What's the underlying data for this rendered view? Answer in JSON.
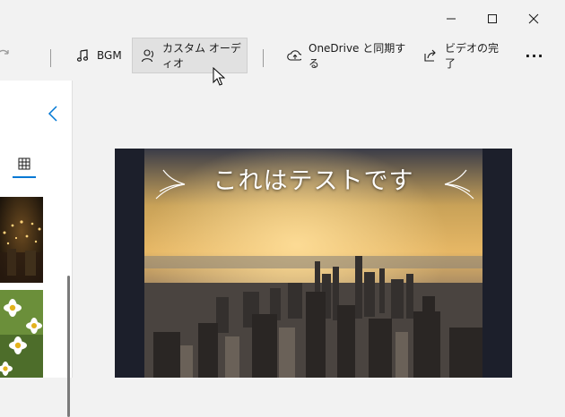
{
  "window": {
    "controls": [
      {
        "name": "minimize",
        "icon": "minimize-icon"
      },
      {
        "name": "maximize",
        "icon": "maximize-icon"
      },
      {
        "name": "close",
        "icon": "close-icon"
      }
    ]
  },
  "toolbar": {
    "redo_icon": "redo-icon",
    "bgm_label": "BGM",
    "custom_audio_label": "カスタム オーディオ",
    "onedrive_label": "OneDrive と同期する",
    "finish_video_label": "ビデオの完了",
    "more_label": "···"
  },
  "panel": {
    "collapse_icon": "chevron-left-icon",
    "grid_icon": "grid-view-icon"
  },
  "preview": {
    "caption": "これはテストです"
  },
  "colors": {
    "accent": "#0078d4",
    "background": "#f2f2f2",
    "preview_bg": "#1c1f2b"
  }
}
